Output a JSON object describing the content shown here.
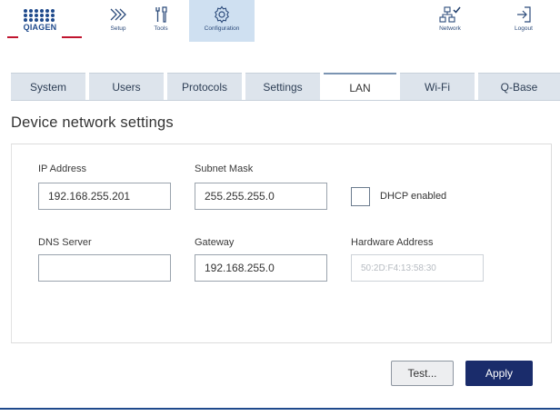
{
  "header": {
    "logo_text": "QIAGEN",
    "nav": [
      {
        "label": "Setup",
        "icon": "chevrons-right-icon"
      },
      {
        "label": "Tools",
        "icon": "tools-icon"
      },
      {
        "label": "Configuration",
        "icon": "gear-icon",
        "active": true
      },
      {
        "label": "Network",
        "icon": "network-icon"
      },
      {
        "label": "Logout",
        "icon": "logout-icon"
      }
    ],
    "accent_color": "#c0152f",
    "brand_color": "#1f4a8c"
  },
  "tabs": [
    {
      "label": "System"
    },
    {
      "label": "Users"
    },
    {
      "label": "Protocols"
    },
    {
      "label": "Settings"
    },
    {
      "label": "LAN",
      "active": true
    },
    {
      "label": "Wi-Fi"
    },
    {
      "label": "Q-Base"
    }
  ],
  "page": {
    "title": "Device network settings"
  },
  "form": {
    "ip_address": {
      "label": "IP Address",
      "value": "192.168.255.201"
    },
    "subnet_mask": {
      "label": "Subnet Mask",
      "value": "255.255.255.0"
    },
    "dhcp": {
      "label": "DHCP enabled",
      "checked": false
    },
    "dns_server": {
      "label": "DNS Server",
      "value": ""
    },
    "gateway": {
      "label": "Gateway",
      "value": "192.168.255.0"
    },
    "hardware_address": {
      "label": "Hardware Address",
      "value": "50:2D:F4:13:58:30"
    }
  },
  "actions": {
    "test_label": "Test...",
    "apply_label": "Apply",
    "apply_color": "#1a2c6b"
  }
}
